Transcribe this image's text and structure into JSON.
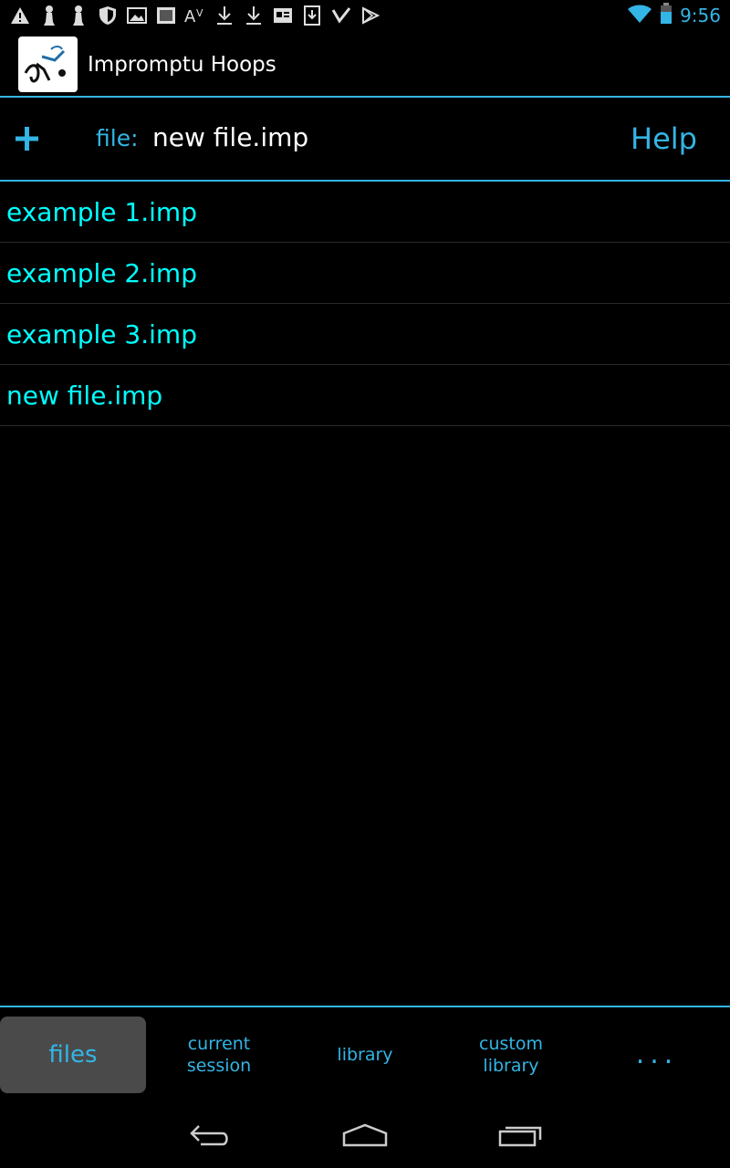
{
  "status_bar": {
    "left_icons": [
      "warning-icon",
      "chess-pawn-icon",
      "chess-pawn-icon",
      "shield-icon",
      "image-icon",
      "sdcard-icon",
      "font-size-icon",
      "download-icon",
      "download-icon",
      "card-icon",
      "download-box-icon",
      "check-icon",
      "play-store-icon"
    ],
    "time": "9:56"
  },
  "app_bar": {
    "title": "Impromptu Hoops"
  },
  "file_bar": {
    "file_label": "file:",
    "file_name": "new file.imp",
    "help_label": "Help"
  },
  "files": [
    "example 1.imp",
    "example 2.imp",
    "example 3.imp",
    "new file.imp"
  ],
  "tabs": {
    "files": "files",
    "current_session": [
      "current",
      "session"
    ],
    "library": "library",
    "custom_library": [
      "custom",
      "library"
    ],
    "more": "..."
  },
  "colors": {
    "accent": "#33b5e5",
    "file_text": "#00ffff",
    "active_tab_bg": "#4a4a4a"
  }
}
